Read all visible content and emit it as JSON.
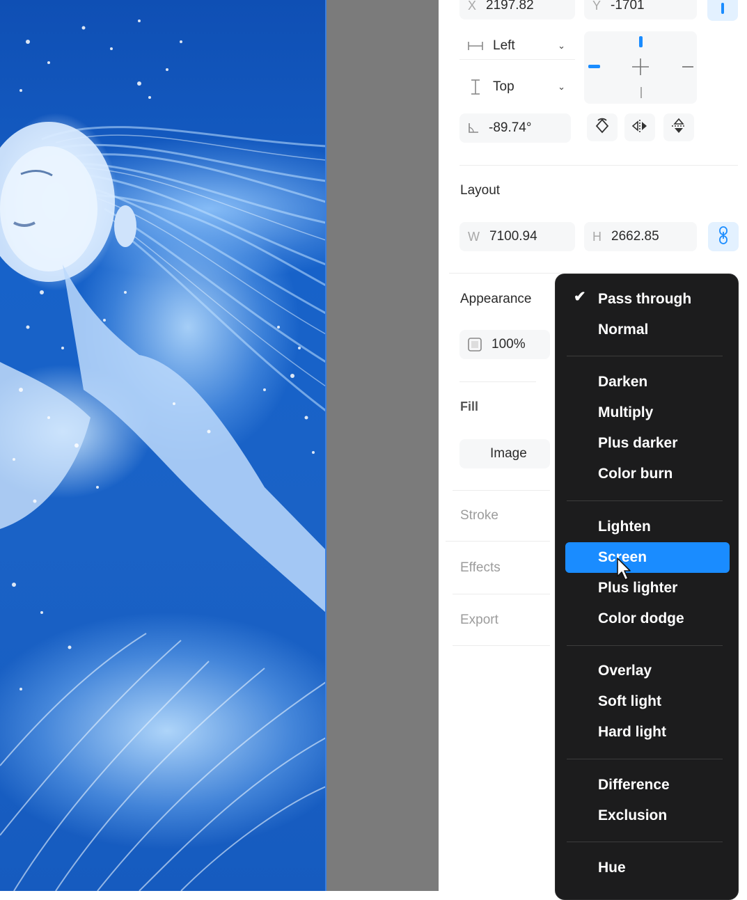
{
  "canvas": {
    "artwork_description_icon": "image-artwork"
  },
  "position": {
    "x_label": "X",
    "x_value": "2197.82",
    "y_label": "Y",
    "y_value": "-1701",
    "h_constraint": "Left",
    "v_constraint": "Top",
    "rotation": "-89.74°"
  },
  "layout": {
    "title": "Layout",
    "w_label": "W",
    "w_value": "7100.94",
    "h_label": "H",
    "h_value": "2662.85"
  },
  "appearance": {
    "title": "Appearance",
    "opacity": "100%"
  },
  "fill": {
    "title": "Fill",
    "type": "Image"
  },
  "sections": {
    "stroke": "Stroke",
    "effects": "Effects",
    "export": "Export"
  },
  "blend_menu": {
    "checked": "Pass through",
    "highlighted": "Screen",
    "groups": [
      [
        "Pass through",
        "Normal"
      ],
      [
        "Darken",
        "Multiply",
        "Plus darker",
        "Color burn"
      ],
      [
        "Lighten",
        "Screen",
        "Plus lighter",
        "Color dodge"
      ],
      [
        "Overlay",
        "Soft light",
        "Hard light"
      ],
      [
        "Difference",
        "Exclusion"
      ],
      [
        "Hue"
      ]
    ]
  },
  "colors": {
    "accent": "#1a8cff",
    "menu_bg": "#1c1c1d",
    "canvas_bg": "#7b7b7b"
  }
}
